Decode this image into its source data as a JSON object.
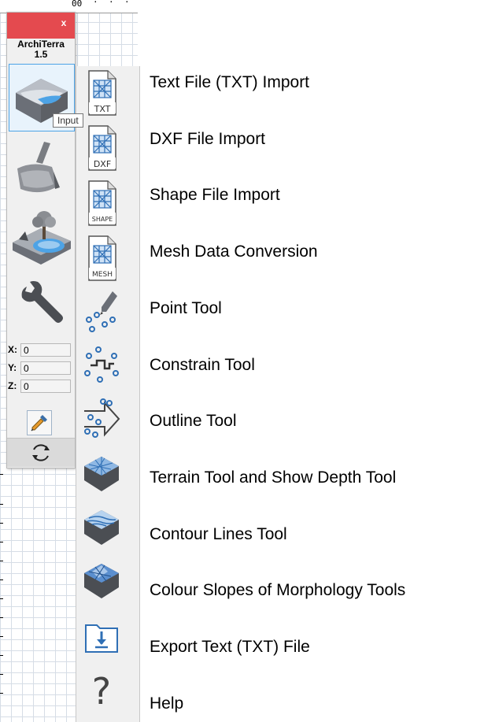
{
  "ruler": {
    "top_text": "00"
  },
  "panel": {
    "close_label": "x",
    "app_name": "ArchiTerra",
    "app_version": "1.5",
    "tooltip": "Input",
    "tools": [
      {
        "name": "input",
        "icon": "terrain-input-icon"
      },
      {
        "name": "excavator",
        "icon": "excavator-bucket-icon"
      },
      {
        "name": "landscape",
        "icon": "tree-pond-icon"
      },
      {
        "name": "settings",
        "icon": "wrench-icon"
      }
    ],
    "coords": [
      {
        "label": "X:",
        "value": "0"
      },
      {
        "label": "Y:",
        "value": "0"
      },
      {
        "label": "Z:",
        "value": "0"
      }
    ],
    "picker_icon": "eyedropper-icon",
    "refresh_icon": "refresh-icon"
  },
  "toolbar": {
    "items": [
      {
        "icon_text": "TXT",
        "label": "Text File (TXT) Import"
      },
      {
        "icon_text": "DXF",
        "label": "DXF File Import"
      },
      {
        "icon_text": "SHAPE",
        "label": "Shape File Import"
      },
      {
        "icon_text": "MESH",
        "label": "Mesh Data Conversion"
      },
      {
        "icon_text": "",
        "label": "Point Tool"
      },
      {
        "icon_text": "",
        "label": "Constrain Tool"
      },
      {
        "icon_text": "",
        "label": "Outline Tool"
      },
      {
        "icon_text": "",
        "label": "Terrain Tool and Show Depth Tool"
      },
      {
        "icon_text": "",
        "label": "Contour Lines Tool"
      },
      {
        "icon_text": "",
        "label": "Colour Slopes of Morphology Tools"
      },
      {
        "icon_text": "",
        "label": "Export Text (TXT) File"
      },
      {
        "icon_text": "?",
        "label": "Help"
      }
    ]
  },
  "colors": {
    "titlebar": "#e44a4f",
    "accent_blue": "#2f6fb5",
    "selection": "#4da3e6"
  }
}
